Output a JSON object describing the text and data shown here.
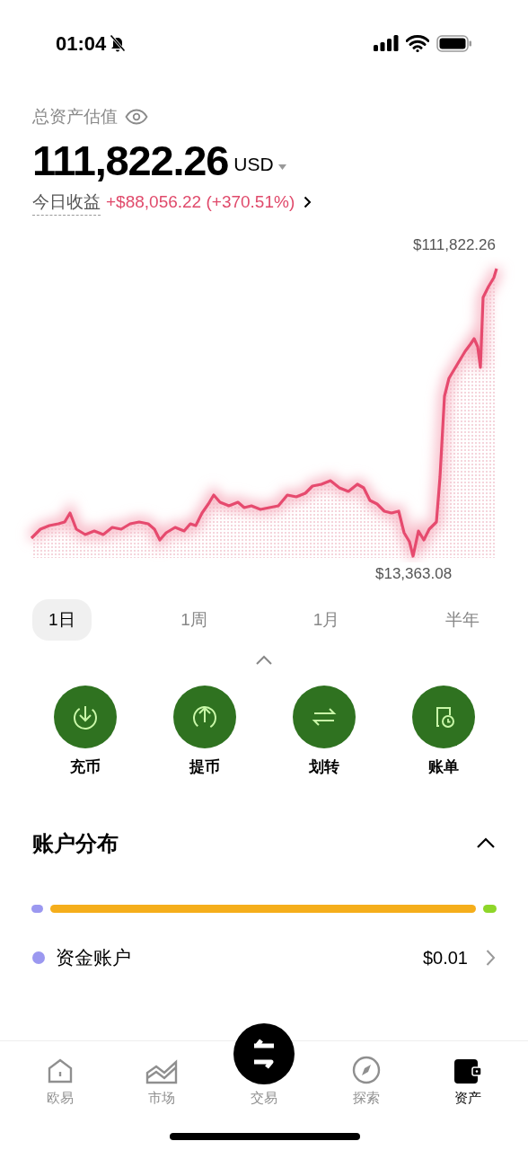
{
  "status_bar": {
    "time": "01:04",
    "silent": true
  },
  "summary": {
    "title": "总资产估值",
    "amount": "111,822.26",
    "currency": "USD",
    "pnl_label": "今日收益",
    "pnl_value": "+$88,056.22 (+370.51%)"
  },
  "chart": {
    "max_label": "$111,822.26",
    "min_label": "$13,363.08"
  },
  "ranges": [
    {
      "label": "1日",
      "selected": true
    },
    {
      "label": "1周",
      "selected": false
    },
    {
      "label": "1月",
      "selected": false
    },
    {
      "label": "半年",
      "selected": false
    }
  ],
  "actions": [
    {
      "kind": "deposit",
      "label": "充币"
    },
    {
      "kind": "withdraw",
      "label": "提币"
    },
    {
      "kind": "transfer",
      "label": "划转"
    },
    {
      "kind": "bill",
      "label": "账单"
    }
  ],
  "distribution": {
    "title": "账户分布",
    "expanded": true,
    "segments": [
      {
        "color": "#9b98f0"
      },
      {
        "color": "#f5ae1b"
      },
      {
        "color": "#8ed629"
      }
    ],
    "accounts": [
      {
        "name": "资金账户",
        "value": "$0.01",
        "color": "#9b98f0"
      }
    ]
  },
  "tab_bar": [
    {
      "kind": "home",
      "label": "欧易",
      "selected": false
    },
    {
      "kind": "market",
      "label": "市场",
      "selected": false
    },
    {
      "kind": "trade",
      "label": "交易",
      "selected": false
    },
    {
      "kind": "explore",
      "label": "探索",
      "selected": false
    },
    {
      "kind": "assets",
      "label": "资产",
      "selected": true
    }
  ]
}
